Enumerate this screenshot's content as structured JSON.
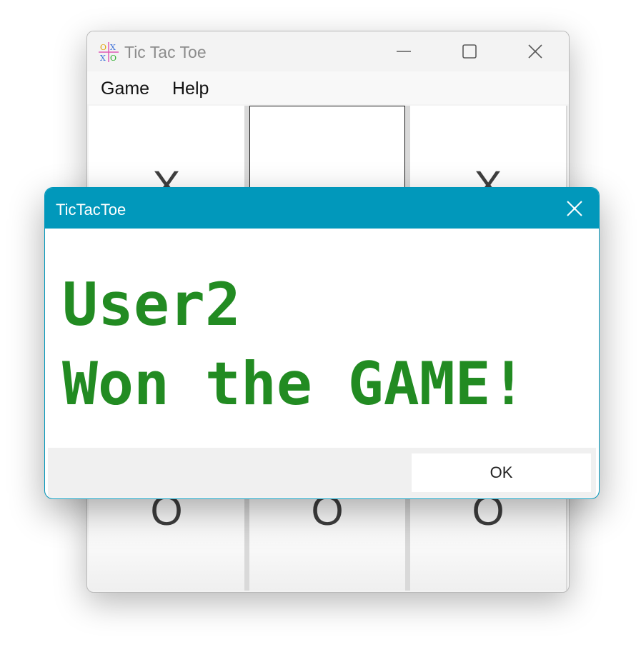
{
  "window": {
    "title": "Tic Tac Toe",
    "icon": "tic-tac-toe-app-icon",
    "controls": {
      "minimize_icon": "minimize-icon",
      "maximize_icon": "maximize-icon",
      "close_icon": "close-icon"
    }
  },
  "menu": {
    "items": [
      {
        "label": "Game"
      },
      {
        "label": "Help"
      }
    ]
  },
  "board": {
    "cells": [
      {
        "value": "X"
      },
      {
        "value": ""
      },
      {
        "value": "X"
      },
      {
        "value": ""
      },
      {
        "value": ""
      },
      {
        "value": ""
      },
      {
        "value": "O"
      },
      {
        "value": "O"
      },
      {
        "value": "O"
      }
    ]
  },
  "dialog": {
    "title": "TicTacToe",
    "close_icon": "close-icon",
    "message_lines": [
      "User2",
      "Won the GAME!"
    ],
    "ok_label": "OK",
    "colors": {
      "titlebar": "#0198bb",
      "message": "#228b22"
    }
  }
}
